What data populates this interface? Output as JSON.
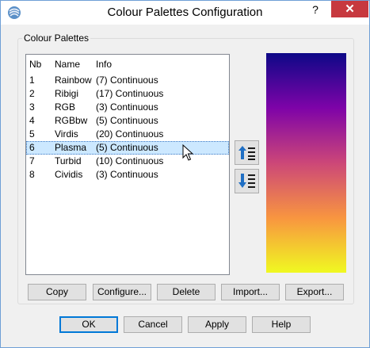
{
  "window": {
    "title": "Colour Palettes Configuration",
    "help_glyph": "?",
    "close_glyph": "✕"
  },
  "group": {
    "label": "Colour Palettes"
  },
  "table": {
    "columns": [
      "Nb",
      "Name",
      "Info"
    ],
    "rows": [
      {
        "nb": "1",
        "name": "Rainbow",
        "info": "(7) Continuous"
      },
      {
        "nb": "2",
        "name": "Ribigi",
        "info": "(17) Continuous"
      },
      {
        "nb": "3",
        "name": "RGB",
        "info": "(3) Continuous"
      },
      {
        "nb": "4",
        "name": "RGBbw",
        "info": "(5) Continuous"
      },
      {
        "nb": "5",
        "name": "Virdis",
        "info": "(20) Continuous"
      },
      {
        "nb": "6",
        "name": "Plasma",
        "info": "(5) Continuous"
      },
      {
        "nb": "7",
        "name": "Turbid",
        "info": "(10) Continuous"
      },
      {
        "nb": "8",
        "name": "Cividis",
        "info": "(3) Continuous"
      }
    ],
    "selected_index": 5
  },
  "preview": {
    "palette": "Plasma",
    "colors": [
      "#0d0887",
      "#7e03a8",
      "#cc4778",
      "#f89540",
      "#f0f921"
    ]
  },
  "side_buttons": {
    "move_up_icon": "move-up-icon",
    "move_down_icon": "move-down-icon"
  },
  "actions": {
    "copy": "Copy",
    "configure": "Configure...",
    "delete": "Delete",
    "import": "Import...",
    "export": "Export..."
  },
  "dialog_buttons": {
    "ok": "OK",
    "cancel": "Cancel",
    "apply": "Apply",
    "help": "Help"
  },
  "colors": {
    "accent": "#0078d7",
    "close_red": "#c7393f",
    "selection": "#cce8ff",
    "window_border": "#6f9fd6"
  }
}
